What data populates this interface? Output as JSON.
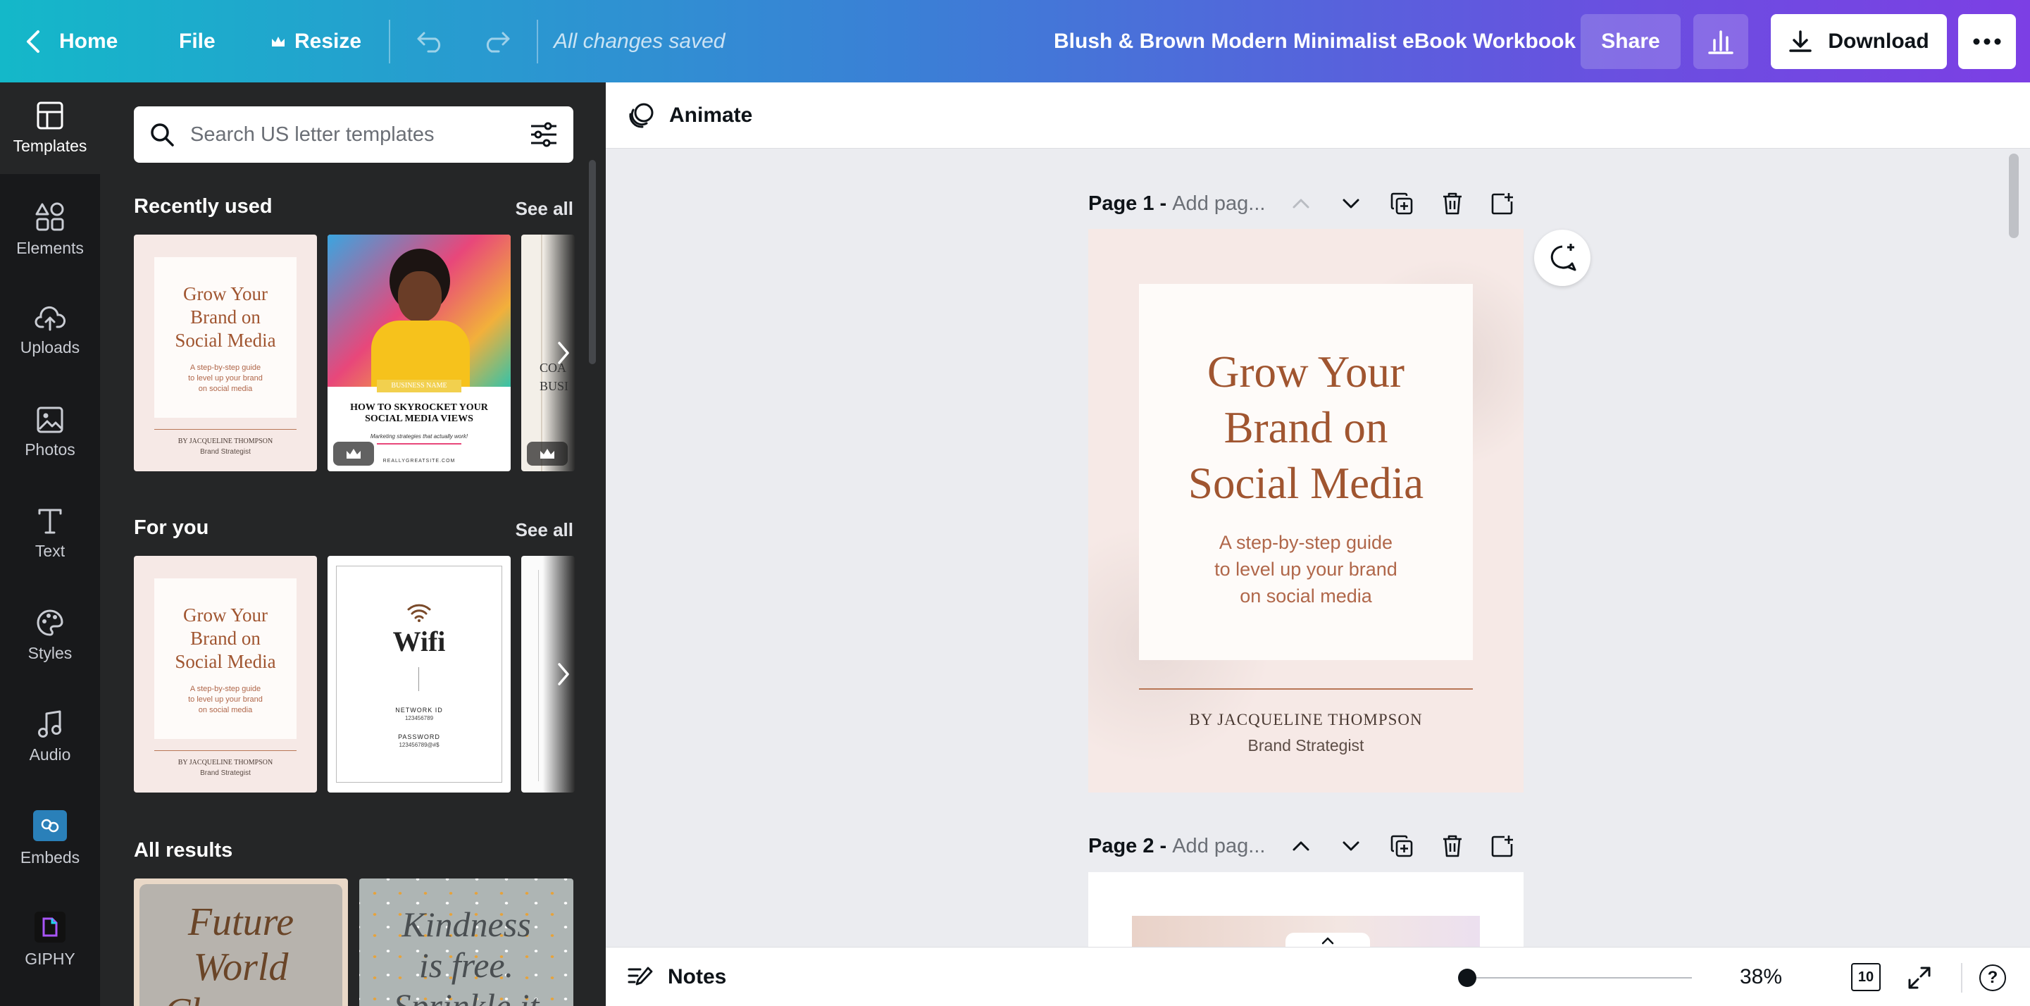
{
  "topbar": {
    "home": "Home",
    "file": "File",
    "resize": "Resize",
    "status": "All changes saved",
    "doc_title": "Blush & Brown Modern Minimalist eBook Workbook",
    "share": "Share",
    "download": "Download"
  },
  "rail": {
    "items": [
      {
        "label": "Templates",
        "icon": "templates-icon"
      },
      {
        "label": "Elements",
        "icon": "elements-icon"
      },
      {
        "label": "Uploads",
        "icon": "uploads-icon"
      },
      {
        "label": "Photos",
        "icon": "photos-icon"
      },
      {
        "label": "Text",
        "icon": "text-icon"
      },
      {
        "label": "Styles",
        "icon": "styles-icon"
      },
      {
        "label": "Audio",
        "icon": "audio-icon"
      },
      {
        "label": "Embeds",
        "icon": "embeds-icon"
      },
      {
        "label": "GIPHY",
        "icon": "giphy-icon"
      }
    ]
  },
  "panel": {
    "search_placeholder": "Search US letter templates",
    "recently_used": "Recently used",
    "for_you": "For you",
    "all_results": "All results",
    "see_all": "See all",
    "thumb_grow": {
      "title_lines": [
        "Grow Your",
        "Brand on",
        "Social Media"
      ],
      "sub_lines": [
        "A step-by-step guide",
        "to level up your brand",
        "on social media"
      ],
      "by": "BY JACQUELINE THOMPSON",
      "role": "Brand Strategist"
    },
    "thumb_skyrocket": {
      "badge": "BUSINESS NAME",
      "title_lines": [
        "HOW TO SKYROCKET YOUR",
        "SOCIAL MEDIA VIEWS"
      ],
      "sub": "Marketing strategies that actually work!",
      "url": "REALLYGREATSITE.COM"
    },
    "thumb_coach": {
      "lines": [
        "COA",
        "BUSI"
      ]
    },
    "thumb_wifi": {
      "title": "Wifi",
      "network_label": "NETWORK ID",
      "network_value": "123456789",
      "password_label": "PASSWORD",
      "password_value": "123456789@#$"
    },
    "result_1": {
      "lines": [
        "Future",
        "World",
        "Changers"
      ]
    },
    "result_2": {
      "lines": [
        "Kindness",
        "is free.",
        "Sprinkle it"
      ]
    }
  },
  "canvas": {
    "animate": "Animate",
    "page1_label": "Page 1 -",
    "page2_label": "Page 2 -",
    "page_title_placeholder": "Add pag...",
    "cover": {
      "title_lines": [
        "Grow Your",
        "Brand on",
        "Social Media"
      ],
      "sub_lines": [
        "A step-by-step guide",
        "to level up your brand",
        "on social media"
      ],
      "by": "BY JACQUELINE THOMPSON",
      "role": "Brand Strategist"
    }
  },
  "bottombar": {
    "notes": "Notes",
    "zoom_percent": 38,
    "zoom": "38%",
    "pages": "10",
    "help": "?"
  },
  "colors": {
    "accent_gradient_start": "#14b8c9",
    "accent_gradient_end": "#7c3fe4",
    "cover_brown": "#a05530",
    "cover_blush": "#f6e9e6",
    "panel_bg": "#252627",
    "rail_bg": "#18191b"
  }
}
